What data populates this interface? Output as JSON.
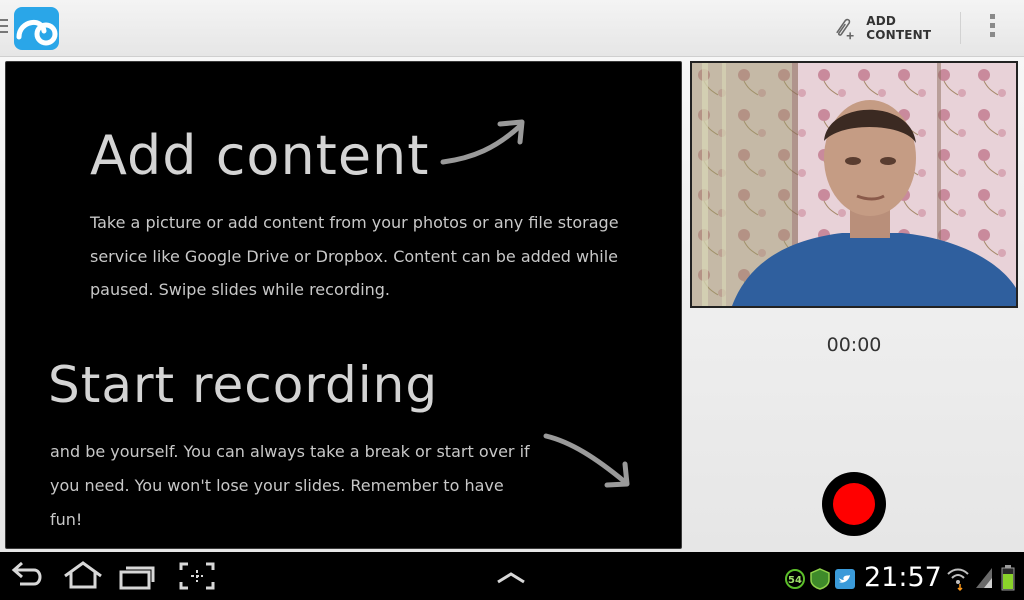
{
  "actionbar": {
    "logo_icon": "app-logo-icon",
    "add_content_label": "ADD CONTENT",
    "add_content_icon": "paperclip-plus-icon",
    "overflow_icon": "overflow-menu-icon"
  },
  "slide": {
    "heading1": "Add content",
    "paragraph1": "Take a picture or add content from your photos or any file storage service like Google Drive or Dropbox. Content can be added while paused. Swipe slides while recording.",
    "heading2": "Start recording",
    "paragraph2": "and be yourself. You can always take a break or start over if you need. You won't lose your slides. Remember to have fun!"
  },
  "recorder": {
    "timer": "00:00",
    "record_icon": "record-icon",
    "record_color": "#ff0000"
  },
  "systembar": {
    "nav_icons": [
      "back-icon",
      "home-icon",
      "recent-apps-icon",
      "screenshot-icon",
      "chevron-up-icon"
    ],
    "notification_badge": "54",
    "notification_icons": [
      "badge-54-icon",
      "shield-app-icon",
      "twitter-icon"
    ],
    "time": "21:57",
    "status_icons": [
      "wifi-icon",
      "signal-icon",
      "battery-icon"
    ]
  },
  "colors": {
    "accent_blue": "#2aa6e8",
    "slide_background": "#000000",
    "battery_green": "#8ad22a"
  }
}
